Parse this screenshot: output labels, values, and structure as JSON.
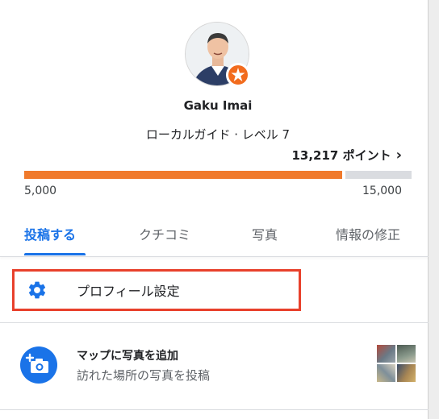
{
  "profile": {
    "name": "Gaku Imai",
    "level_text": "ローカルガイド · レベル 7",
    "points_text": "13,217 ポイント",
    "progress": {
      "min_label": "5,000",
      "max_label": "15,000",
      "fraction": 0.82
    }
  },
  "tabs": [
    {
      "label": "投稿する",
      "active": true
    },
    {
      "label": "クチコミ",
      "active": false
    },
    {
      "label": "写真",
      "active": false
    },
    {
      "label": "情報の修正",
      "active": false
    }
  ],
  "settings": {
    "label": "プロフィール設定",
    "icon": "gear-icon"
  },
  "add_photo": {
    "title": "マップに写真を追加",
    "subtitle": "訪れた場所の写真を投稿",
    "icon": "add-photo-icon"
  },
  "colors": {
    "accent": "#1a73e8",
    "progress": "#f07a2c",
    "badge": "#f26b1d",
    "highlight": "#e8402b"
  }
}
